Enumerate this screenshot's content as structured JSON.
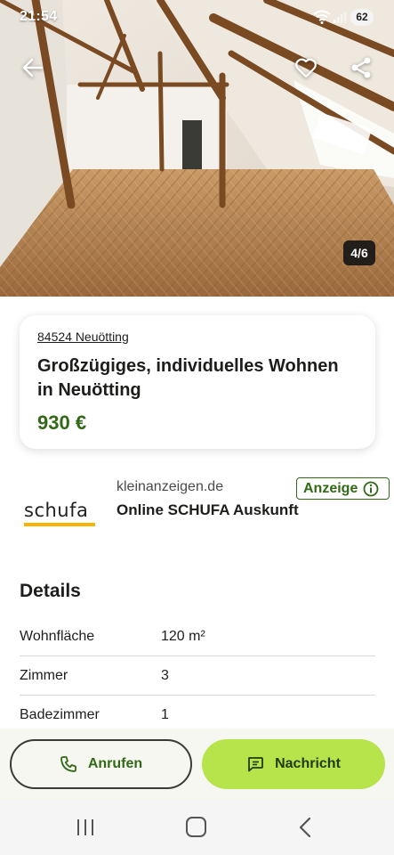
{
  "status_bar": {
    "time": "21:54",
    "battery": "62"
  },
  "hero": {
    "counter": "4/6"
  },
  "listing": {
    "location": "84524 Neuötting",
    "title": "Großzügiges, individuelles Wohnen in Neuötting",
    "price": "930 €"
  },
  "ad": {
    "logo_text": "schufa",
    "domain": "kleinanzeigen.de",
    "headline": "Online SCHUFA Auskunft",
    "badge": "Anzeige"
  },
  "details": {
    "heading": "Details",
    "rows": [
      {
        "label": "Wohnfläche",
        "value": "120 m²"
      },
      {
        "label": "Zimmer",
        "value": "3"
      },
      {
        "label": "Badezimmer",
        "value": "1"
      }
    ]
  },
  "actions": {
    "call_label": "Anrufen",
    "message_label": "Nachricht"
  },
  "colors": {
    "accent_green": "#326916",
    "cta_lime": "#b7e34b",
    "schufa_yellow": "#f5b400"
  },
  "icons": [
    "back-arrow-icon",
    "heart-icon",
    "share-icon",
    "wifi-icon",
    "signal-icon",
    "phone-icon",
    "message-icon",
    "info-icon",
    "recent-apps-icon",
    "home-icon",
    "nav-back-icon"
  ]
}
